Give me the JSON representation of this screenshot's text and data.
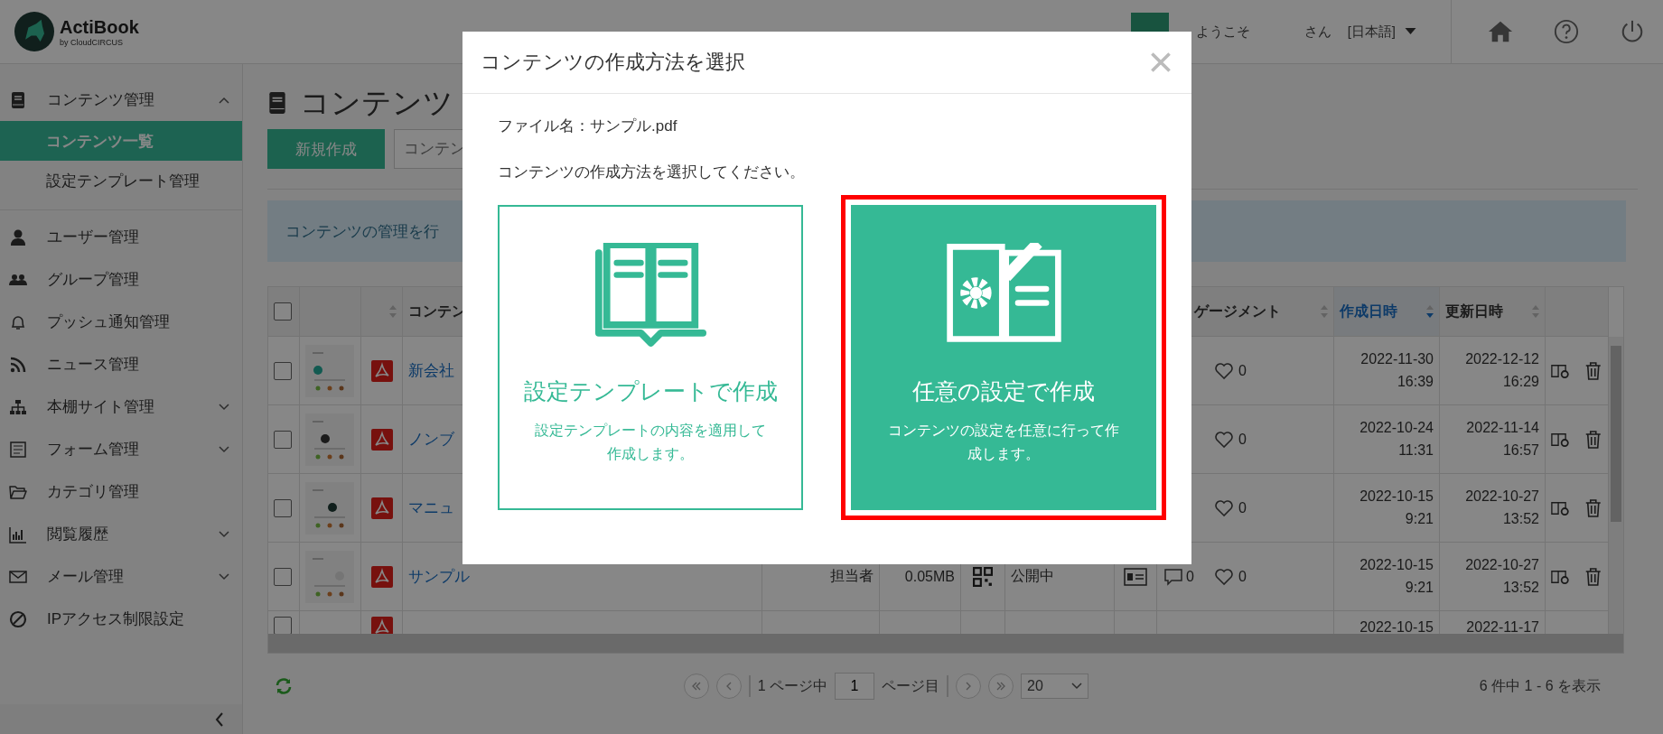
{
  "header": {
    "logo": "ActiBook",
    "logo_sub": "by CloudCIRCUS",
    "welcome": "ようこそ",
    "honorific": "さん",
    "language": "[日本語]"
  },
  "sidebar": {
    "items": [
      {
        "label": "コンテンツ管理",
        "expanded": true,
        "children": [
          {
            "label": "コンテンツ一覧",
            "selected": true
          },
          {
            "label": "設定テンプレート管理",
            "selected": false
          }
        ]
      },
      {
        "label": "ユーザー管理",
        "expanded": false
      },
      {
        "label": "グループ管理",
        "expanded": false
      },
      {
        "label": "プッシュ通知管理",
        "expanded": false
      },
      {
        "label": "ニュース管理",
        "expanded": false
      },
      {
        "label": "本棚サイト管理",
        "expanded": false,
        "has_children": true
      },
      {
        "label": "フォーム管理",
        "expanded": false,
        "has_children": true
      },
      {
        "label": "カテゴリ管理",
        "expanded": false
      },
      {
        "label": "閲覧履歴",
        "expanded": false,
        "has_children": true
      },
      {
        "label": "メール管理",
        "expanded": false,
        "has_children": true
      },
      {
        "label": "IPアクセス制限設定",
        "expanded": false
      }
    ]
  },
  "page": {
    "title": "コンテンツ",
    "new_button": "新規作成",
    "search_placeholder": "コンテン",
    "info": "コンテンツの管理を行"
  },
  "table": {
    "select_all": {
      "checked": false
    },
    "columns": [
      {
        "label": "コンテン",
        "sorted": false
      },
      {
        "label": "ゲージメント",
        "sorted": false
      },
      {
        "label": "作成日時",
        "sorted": true
      },
      {
        "label": "更新日時",
        "sorted": false
      }
    ],
    "rows": [
      {
        "checked": false,
        "name": "新会社",
        "likes": "0",
        "created": [
          "2022-11-30",
          "16:39"
        ],
        "updated": [
          "2022-12-12",
          "16:29"
        ]
      },
      {
        "checked": false,
        "name": "ノンブ",
        "likes": "0",
        "created": [
          "2022-10-24",
          "11:31"
        ],
        "updated": [
          "2022-11-14",
          "16:57"
        ]
      },
      {
        "checked": false,
        "name": "マニュ",
        "likes": "0",
        "created": [
          "2022-10-15",
          "9:21"
        ],
        "updated": [
          "2022-10-27",
          "13:52"
        ]
      },
      {
        "checked": false,
        "name": "サンプル",
        "owner": "担当者",
        "size": "0.05MB",
        "status": "公開中",
        "comments": "0",
        "likes": "0",
        "created": [
          "2022-10-15",
          "9:21"
        ],
        "updated": [
          "2022-10-27",
          "13:52"
        ]
      },
      {
        "checked": false,
        "created": [
          "2022-10-15"
        ],
        "updated": [
          "2022-11-17"
        ]
      }
    ]
  },
  "pagination": {
    "of_pages": "1 ページ中",
    "page": "1",
    "page_suffix": "ページ目",
    "per_page": "20",
    "summary": "6 件中 1 - 6 を表示"
  },
  "modal": {
    "title": "コンテンツの作成方法を選択",
    "file": "ファイル名：サンプル.pdf",
    "prompt": "コンテンツの作成方法を選択してください。",
    "options": [
      {
        "kind": "template",
        "title": "設定テンプレートで作成",
        "description": "設定テンプレートの内容を適用して作成します。",
        "filled": false,
        "highlighted": false
      },
      {
        "kind": "custom",
        "title": "任意の設定で作成",
        "description": "コンテンツの設定を任意に行って作成します。",
        "filled": true,
        "highlighted": true
      }
    ]
  }
}
